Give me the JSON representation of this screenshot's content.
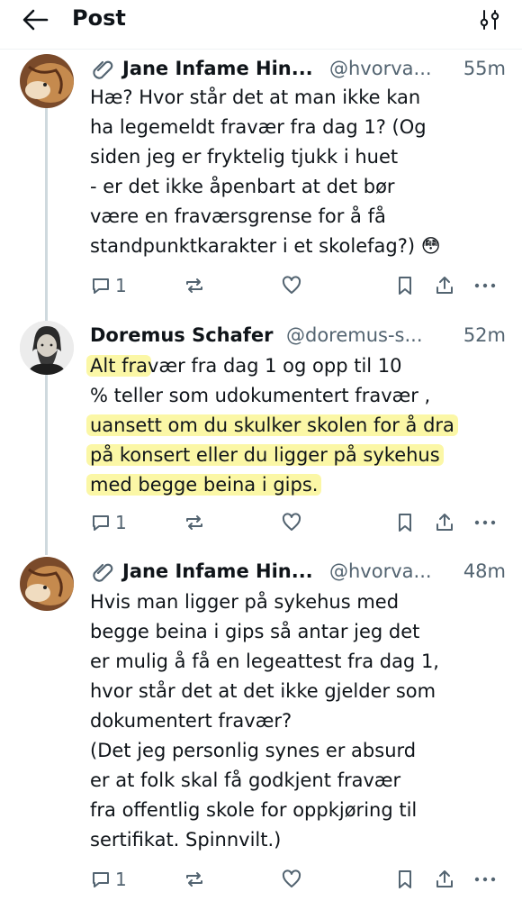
{
  "topbar": {
    "title": "Post",
    "back_icon": "arrow-left-icon",
    "filter_icon": "filter-sliders-icon"
  },
  "posts": [
    {
      "name": "Jane Infame Hin...",
      "handle": "@hvorva...",
      "time": "55m",
      "badge_icon": "paperclip-icon",
      "lines": [
        "Hæ? Hvor står det at man ikke kan",
        "ha legemeldt fravær fra dag 1? (Og",
        "siden jeg er fryktelig tjukk i huet",
        "- er det ikke åpenbart at det bør",
        "være en fraværsgrense for å få",
        "standpunktkarakter i et skolefag?)"
      ],
      "emoji": "😳",
      "reply_count": "1"
    },
    {
      "name": "Doremus Schafer",
      "handle": "@doremus-s...",
      "time": "52m",
      "line1_highlight": "Alt fra",
      "line1_rest": "vær fra dag 1 og opp til 10",
      "line2": "% teller som udokumentert fravær ,",
      "highlighted_lines": [
        "uansett om du skulker skolen for å dra",
        "på konsert eller du ligger på sykehus",
        "med begge beina i gips."
      ],
      "reply_count": "1"
    },
    {
      "name": "Jane Infame Hin...",
      "handle": "@hvorva...",
      "time": "48m",
      "badge_icon": "paperclip-icon",
      "lines": [
        "Hvis man ligger på sykehus med",
        "begge beina i gips så antar jeg det",
        "er mulig å få en legeattest fra dag 1,",
        "hvor står det at det ikke gjelder som",
        "dokumentert fravær?",
        "(Det jeg personlig synes er absurd",
        "er at folk skal få godkjent fravær",
        "fra offentlig skole for oppkjøring til",
        "sertifikat. Spinnvilt.)"
      ],
      "reply_count": "1"
    }
  ],
  "colors": {
    "text": "#0f1419",
    "secondary": "#536471",
    "highlight": "#fbf7a6",
    "thread_line": "#cfd9de"
  }
}
